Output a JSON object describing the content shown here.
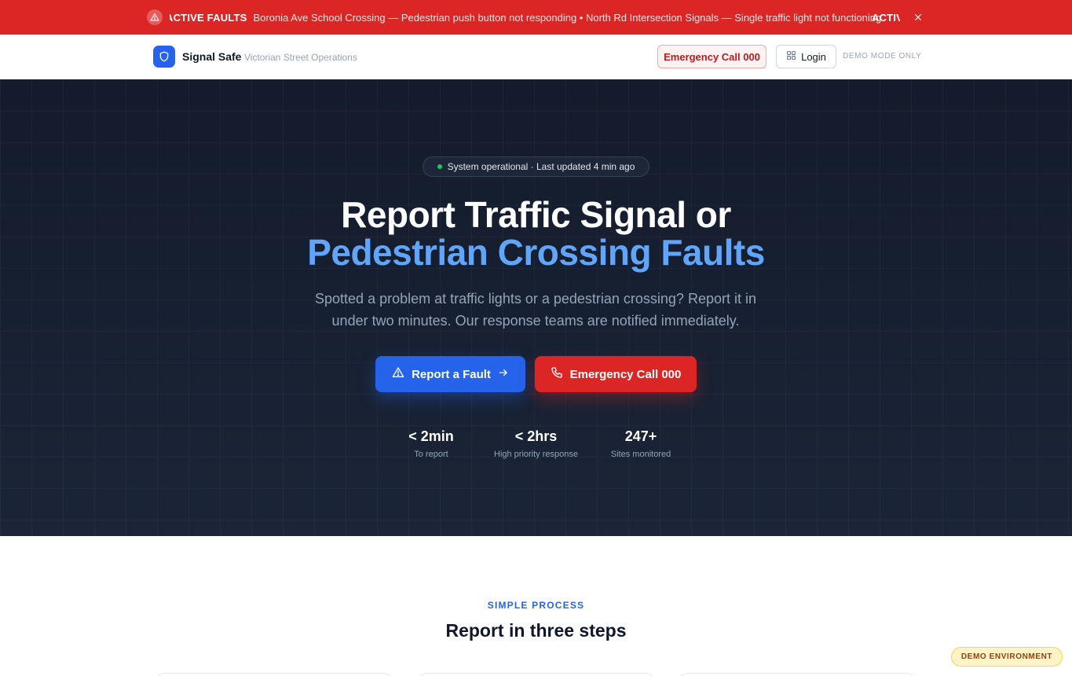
{
  "alert": {
    "label": "ACTIVE FAULTS",
    "ticker_text": "Boronia Ave School Crossing — Pedestrian push button not responding • North Rd Intersection Signals — Single traffic light not functioning",
    "label_repeat": "ACTIV",
    "icons": {
      "warning": "warning-triangle-icon",
      "close": "close-icon"
    }
  },
  "header": {
    "brand_name": "Signal Safe",
    "brand_subtitle": "Victorian Street Operations",
    "emergency_label": "Emergency Call 000",
    "login_label": "Login",
    "demo_note": "DEMO MODE ONLY",
    "icons": {
      "logo": "shield-icon",
      "login": "grid-icon"
    }
  },
  "hero": {
    "status": "System operational · Last updated 4 min ago",
    "title_line1": "Report Traffic Signal or",
    "title_line2": "Pedestrian Crossing Faults",
    "description": "Spotted a problem at traffic lights or a pedestrian crossing? Report it in under two minutes. Our response teams are notified immediately.",
    "report_button": "Report a Fault",
    "emergency_button": "Emergency Call 000",
    "stats": [
      {
        "value": "< 2min",
        "label": "To report"
      },
      {
        "value": "< 2hrs",
        "label": "High priority response"
      },
      {
        "value": "247+",
        "label": "Sites monitored"
      }
    ],
    "icons": {
      "report": "warning-triangle-icon",
      "arrow": "arrow-right-icon",
      "phone": "phone-icon"
    }
  },
  "process": {
    "eyebrow": "SIMPLE PROCESS",
    "title": "Report in three steps"
  },
  "demo_badge": "DEMO ENVIRONMENT",
  "colors": {
    "alert": "#dc2626",
    "primary": "#2563eb",
    "accent_text": "#60a5fa",
    "hero_bg": "#172033",
    "status_dot": "#22c55e"
  }
}
